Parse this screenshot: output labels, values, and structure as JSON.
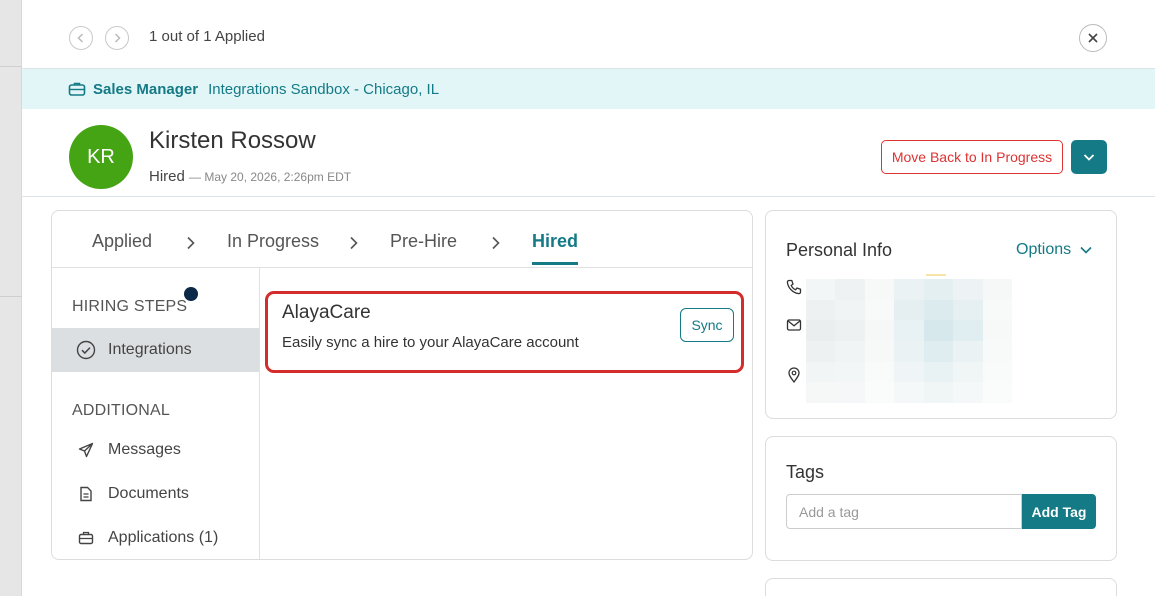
{
  "nav": {
    "counter": "1 out of 1 Applied",
    "prev_icon": "chevron-left-icon",
    "next_icon": "chevron-right-icon",
    "close_icon": "close-icon"
  },
  "job": {
    "title": "Sales Manager",
    "location": "Integrations Sandbox - Chicago, IL",
    "icon": "briefcase-icon"
  },
  "candidate": {
    "initials": "KR",
    "name": "Kirsten Rossow",
    "status": "Hired",
    "timestamp": "— May 20, 2026, 2:26pm EDT",
    "move_back_label": "Move Back to In Progress"
  },
  "stages": {
    "items": [
      {
        "label": "Applied"
      },
      {
        "label": "In Progress"
      },
      {
        "label": "Pre-Hire"
      },
      {
        "label": "Hired"
      }
    ],
    "active": "Hired"
  },
  "sidebar": {
    "hiring_steps_title": "HIRING STEPS",
    "hiring_steps": [
      {
        "label": "Integrations",
        "icon": "check-circle-icon",
        "active": true
      }
    ],
    "additional_title": "ADDITIONAL",
    "additional": [
      {
        "label": "Messages",
        "icon": "paper-plane-icon"
      },
      {
        "label": "Documents",
        "icon": "document-icon"
      },
      {
        "label": "Applications (1)",
        "icon": "briefcase-icon"
      }
    ]
  },
  "integration": {
    "name": "AlayaCare",
    "description": "Easily sync a hire to your AlayaCare account",
    "sync_label": "Sync"
  },
  "personal_info": {
    "title": "Personal Info",
    "options_label": "Options",
    "icons": [
      "phone-icon",
      "email-icon",
      "location-pin-icon"
    ]
  },
  "tags": {
    "title": "Tags",
    "placeholder": "Add a tag",
    "add_label": "Add Tag"
  },
  "colors": {
    "accent": "#147a85",
    "danger": "#d33333",
    "avatar": "#45a414",
    "banner": "#e2f6f8",
    "highlight": "#d42c2c"
  }
}
